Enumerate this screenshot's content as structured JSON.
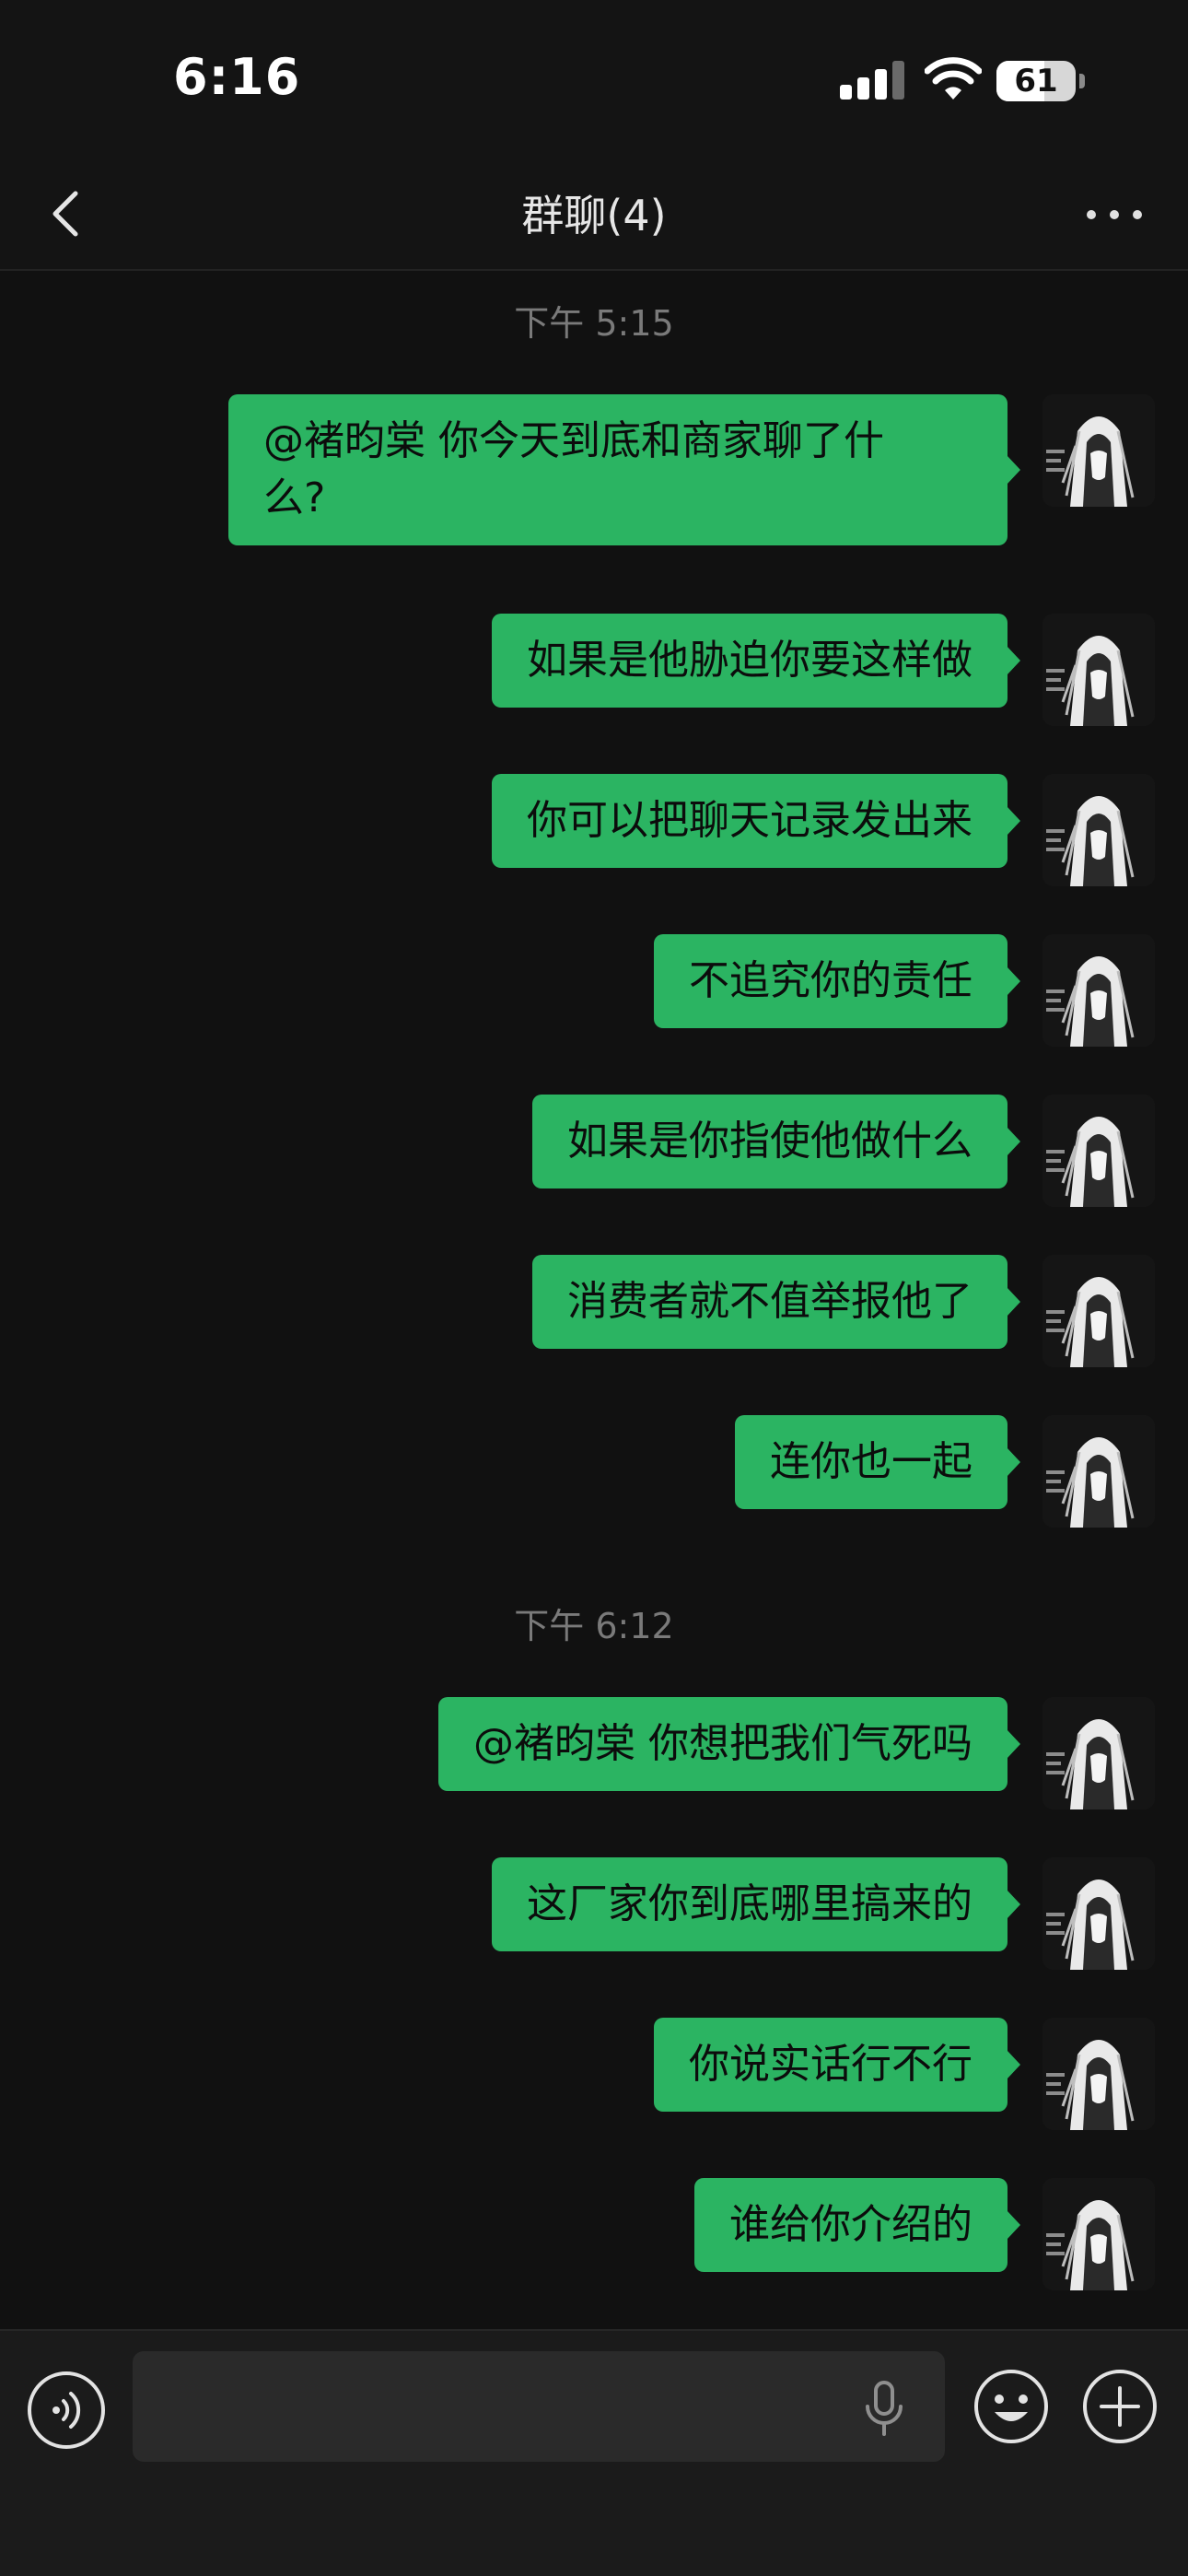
{
  "status_bar": {
    "time": "6:16",
    "battery_percent": "61",
    "battery_level": 0.61,
    "signal_bars": 3
  },
  "nav": {
    "title": "群聊(4)",
    "back_icon": "chevron-left-icon",
    "more_icon": "more-dots-icon"
  },
  "chat": {
    "groups": [
      {
        "timestamp": "下午 5:15",
        "messages": [
          "@褚昀棠 你今天到底和商家聊了什\n么?",
          "如果是他胁迫你要这样做",
          "你可以把聊天记录发出来",
          "不追究你的责任",
          "如果是你指使他做什么",
          "消费者就不值举报他了",
          "连你也一起"
        ]
      },
      {
        "timestamp": "下午 6:12",
        "messages": [
          "@褚昀棠 你想把我们气死吗",
          "这厂家你到底哪里搞来的",
          "你说实话行不行",
          "谁给你介绍的"
        ]
      }
    ]
  },
  "input_bar": {
    "value": "",
    "voice_icon": "voice-input-icon",
    "mic_icon": "microphone-icon",
    "emoji_icon": "emoji-icon",
    "plus_icon": "plus-icon"
  },
  "colors": {
    "background": "#111111",
    "bubble": "#2bb462",
    "timestamp": "#7a7a7a"
  }
}
